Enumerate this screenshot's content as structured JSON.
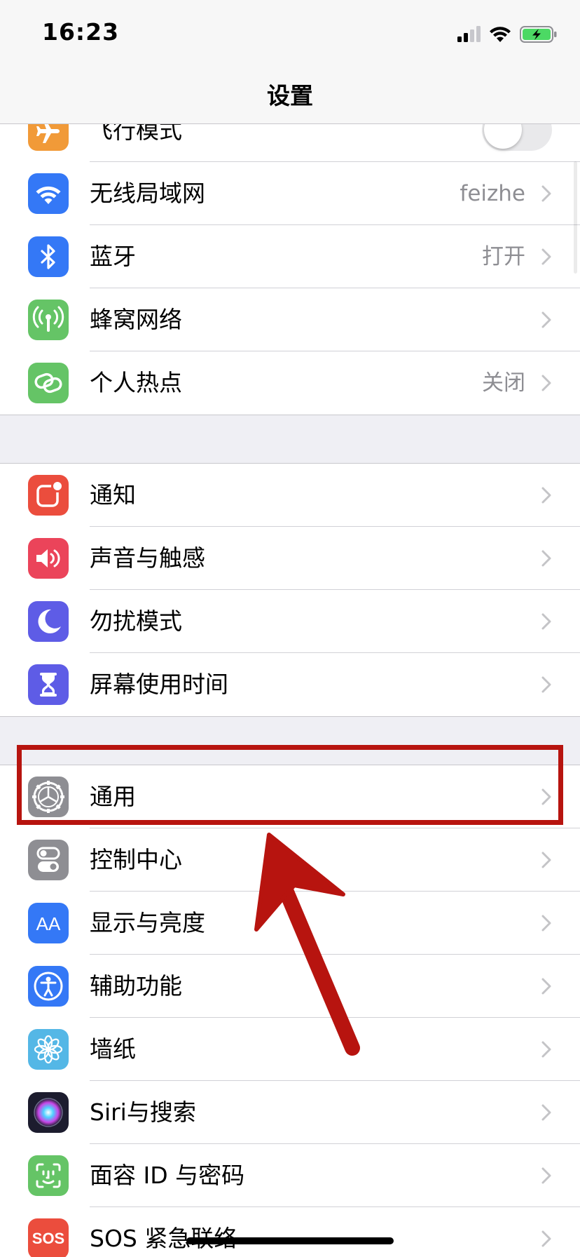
{
  "status_bar": {
    "time": "16:23"
  },
  "nav": {
    "title": "设置"
  },
  "groups": [
    {
      "id": "connectivity",
      "items": [
        {
          "label": "飞行模式",
          "value": "",
          "icon": "airplane-icon",
          "color": "#f19a38",
          "control": "toggle",
          "toggle_on": false
        },
        {
          "label": "无线局域网",
          "value": "feizhe",
          "icon": "wifi-icon",
          "color": "#3478f6",
          "control": "chevron"
        },
        {
          "label": "蓝牙",
          "value": "打开",
          "icon": "bluetooth-icon",
          "color": "#3478f6",
          "control": "chevron"
        },
        {
          "label": "蜂窝网络",
          "value": "",
          "icon": "antenna-icon",
          "color": "#65c466",
          "control": "chevron"
        },
        {
          "label": "个人热点",
          "value": "关闭",
          "icon": "hotspot-link-icon",
          "color": "#65c466",
          "control": "chevron"
        }
      ]
    },
    {
      "id": "notifications",
      "items": [
        {
          "label": "通知",
          "value": "",
          "icon": "notification-icon",
          "color": "#eb4d3d",
          "control": "chevron"
        },
        {
          "label": "声音与触感",
          "value": "",
          "icon": "speaker-icon",
          "color": "#eb445a",
          "control": "chevron"
        },
        {
          "label": "勿扰模式",
          "value": "",
          "icon": "moon-icon",
          "color": "#5e5ce6",
          "control": "chevron"
        },
        {
          "label": "屏幕使用时间",
          "value": "",
          "icon": "hourglass-icon",
          "color": "#5e5ce6",
          "control": "chevron"
        }
      ]
    },
    {
      "id": "system",
      "items": [
        {
          "label": "通用",
          "value": "",
          "icon": "gear-icon",
          "color": "#8e8e93",
          "control": "chevron"
        },
        {
          "label": "控制中心",
          "value": "",
          "icon": "switches-icon",
          "color": "#8e8e93",
          "control": "chevron"
        },
        {
          "label": "显示与亮度",
          "value": "",
          "icon": "text-size-icon",
          "color": "#3478f6",
          "control": "chevron"
        },
        {
          "label": "辅助功能",
          "value": "",
          "icon": "accessibility-icon",
          "color": "#3478f6",
          "control": "chevron"
        },
        {
          "label": "墙纸",
          "value": "",
          "icon": "flower-icon",
          "color": "#54b7e6",
          "control": "chevron"
        },
        {
          "label": "Siri与搜索",
          "value": "",
          "icon": "siri-icon",
          "color": "#1c1c2e",
          "control": "chevron"
        },
        {
          "label": "面容 ID 与密码",
          "value": "",
          "icon": "face-id-icon",
          "color": "#65c466",
          "control": "chevron"
        },
        {
          "label": "SOS 紧急联络",
          "value": "",
          "icon": "sos-icon",
          "color": "#eb4d3d",
          "control": "chevron",
          "icon_text": "SOS"
        }
      ]
    }
  ],
  "annotation": {
    "color": "#b7140f",
    "highlighted_item": "通用"
  }
}
